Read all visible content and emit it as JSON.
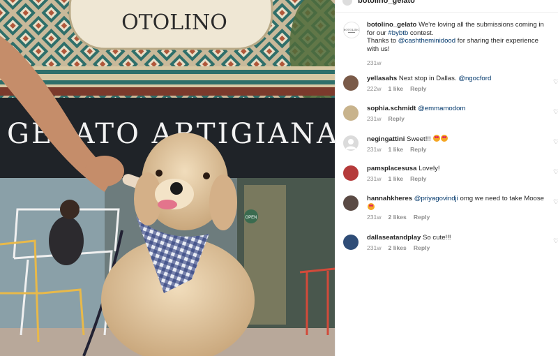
{
  "photo": {
    "sign_text": "OTOLINO",
    "shop_text": "GELATO ARTIGIANALE",
    "open_sign": "OPEN"
  },
  "header": {
    "username": "botolino_gelato"
  },
  "caption": {
    "username": "botolino_gelato",
    "text1": "We're loving all the submissions coming in for our ",
    "hashtag": "#bybtb",
    "text2": " contest.",
    "text3": "Thanks to ",
    "mention": "@cashtheminidood",
    "text4": " for sharing their experience with us!",
    "time": "231w"
  },
  "comments": [
    {
      "username": "yellasahs",
      "text": "Next stop in Dallas. ",
      "mention": "@ngocford",
      "time": "222w",
      "likes": "1 like",
      "reply": "Reply",
      "avatar_color": "#7a5a48"
    },
    {
      "username": "sophia.schmidt",
      "text": "",
      "mention": "@emmamodom",
      "time": "231w",
      "likes": "",
      "reply": "Reply",
      "avatar_color": "#c8b38c"
    },
    {
      "username": "negingattini",
      "text": "Sweet!!! ",
      "mention": "",
      "time": "231w",
      "likes": "1 like",
      "reply": "Reply",
      "avatar_color": "#dbdbdb"
    },
    {
      "username": "pamsplacesusa",
      "text": "Lovely!",
      "mention": "",
      "time": "231w",
      "likes": "1 like",
      "reply": "Reply",
      "avatar_color": "#b53a3a"
    },
    {
      "username": "hannahkheres",
      "text": " omg we need to take Moose ",
      "mention": "@priyagovindji",
      "time": "231w",
      "likes": "2 likes",
      "reply": "Reply",
      "avatar_color": "#5a4a44"
    },
    {
      "username": "dallaseatandplay",
      "text": "So cute!!!",
      "mention": "",
      "time": "231w",
      "likes": "2 likes",
      "reply": "Reply",
      "avatar_color": "#2f4d77"
    }
  ]
}
